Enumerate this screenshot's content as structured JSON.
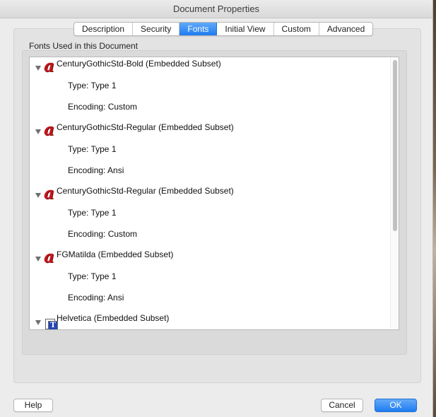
{
  "window": {
    "title": "Document Properties"
  },
  "tabs": [
    {
      "label": "Description",
      "active": false
    },
    {
      "label": "Security",
      "active": false
    },
    {
      "label": "Fonts",
      "active": true
    },
    {
      "label": "Initial View",
      "active": false
    },
    {
      "label": "Custom",
      "active": false
    },
    {
      "label": "Advanced",
      "active": false
    }
  ],
  "fonts_section": {
    "label": "Fonts Used in this Document",
    "fonts": [
      {
        "name": "CenturyGothicStd-Bold (Embedded Subset)",
        "icon": "opentype-font-icon",
        "type": "Type: Type 1",
        "encoding": "Encoding: Custom"
      },
      {
        "name": "CenturyGothicStd-Regular (Embedded Subset)",
        "icon": "opentype-font-icon",
        "type": "Type: Type 1",
        "encoding": "Encoding: Ansi"
      },
      {
        "name": "CenturyGothicStd-Regular (Embedded Subset)",
        "icon": "opentype-font-icon",
        "type": "Type: Type 1",
        "encoding": "Encoding: Custom"
      },
      {
        "name": "FGMatilda (Embedded Subset)",
        "icon": "opentype-font-icon",
        "type": "Type: Type 1",
        "encoding": "Encoding: Ansi"
      },
      {
        "name": "Helvetica (Embedded Subset)",
        "icon": "type1-font-icon"
      }
    ]
  },
  "buttons": {
    "help": "Help",
    "cancel": "Cancel",
    "ok": "OK"
  },
  "colors": {
    "accent": "#1f7cf1",
    "font_icon": "#c4161c"
  }
}
